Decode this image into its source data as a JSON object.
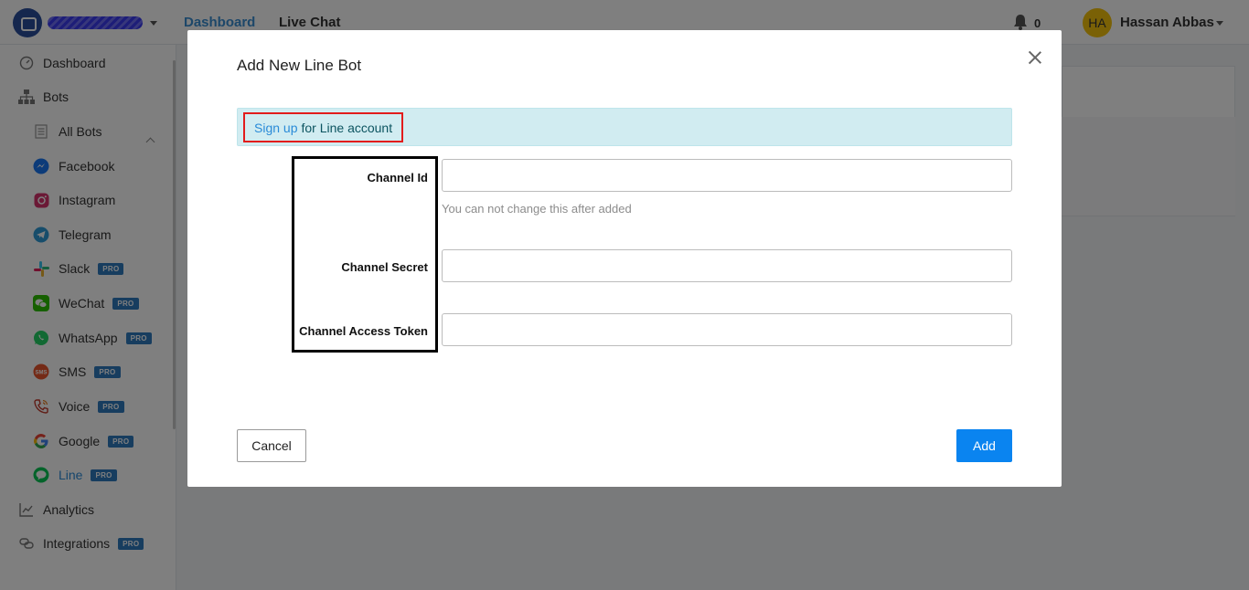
{
  "navbar": {
    "links": {
      "dashboard": "Dashboard",
      "live_chat": "Live Chat"
    },
    "notifications_count": "0",
    "user": {
      "initials": "HA",
      "name": "Hassan Abbas"
    }
  },
  "sidebar": {
    "dashboard": "Dashboard",
    "bots": "Bots",
    "all_bots": "All Bots",
    "facebook": "Facebook",
    "instagram": "Instagram",
    "telegram": "Telegram",
    "slack": "Slack",
    "wechat": "WeChat",
    "whatsapp": "WhatsApp",
    "sms": "SMS",
    "voice": "Voice",
    "google": "Google",
    "line": "Line",
    "analytics": "Analytics",
    "integrations": "Integrations",
    "pro_badge": "PRO",
    "sms_icon_text": "SMS"
  },
  "modal": {
    "title": "Add New Line Bot",
    "signup_link": "Sign up",
    "signup_rest": "for Line account",
    "fields": {
      "channel_id": {
        "label": "Channel Id",
        "value": "",
        "help": "You can not change this after added"
      },
      "channel_secret": {
        "label": "Channel Secret",
        "value": ""
      },
      "channel_access_token": {
        "label": "Channel Access Token",
        "value": ""
      }
    },
    "cancel_label": "Cancel",
    "add_label": "Add"
  },
  "colors": {
    "accent": "#0a84f0",
    "link": "#2a8bd8",
    "info_bg": "#d1ecf1",
    "pro_badge": "#2e7bbf",
    "highlight_red": "#e21c1c"
  }
}
